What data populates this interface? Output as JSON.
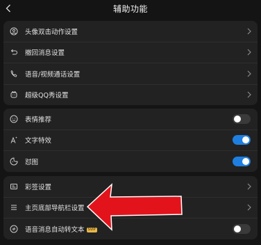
{
  "header": {
    "title": "辅助功能"
  },
  "group1": [
    {
      "label": "头像双击动作设置",
      "icon": "user-circle-icon"
    },
    {
      "label": "撤回消息设置",
      "icon": "undo-icon"
    },
    {
      "label": "语音/视频通话设置",
      "icon": "phone-icon"
    },
    {
      "label": "超级QQ秀设置",
      "icon": "qq-show-icon"
    }
  ],
  "group2": [
    {
      "label": "表情推荐",
      "icon": "emoji-icon",
      "toggle": "off"
    },
    {
      "label": "文字特效",
      "icon": "text-effect-icon",
      "toggle": "on"
    },
    {
      "label": "怼图",
      "icon": "sticker-icon",
      "toggle": "on"
    }
  ],
  "group3": [
    {
      "label": "彩签设置",
      "icon": "tag-card-icon"
    },
    {
      "label": "主页底部导航栏设置",
      "icon": "menu-lines-icon"
    },
    {
      "label": "语音消息自动转文本",
      "icon": "voice-convert-icon",
      "badge": "SVIP",
      "toggle": "off"
    }
  ],
  "colors": {
    "accent": "#1f7fe0",
    "annotation": "#e3131b"
  }
}
